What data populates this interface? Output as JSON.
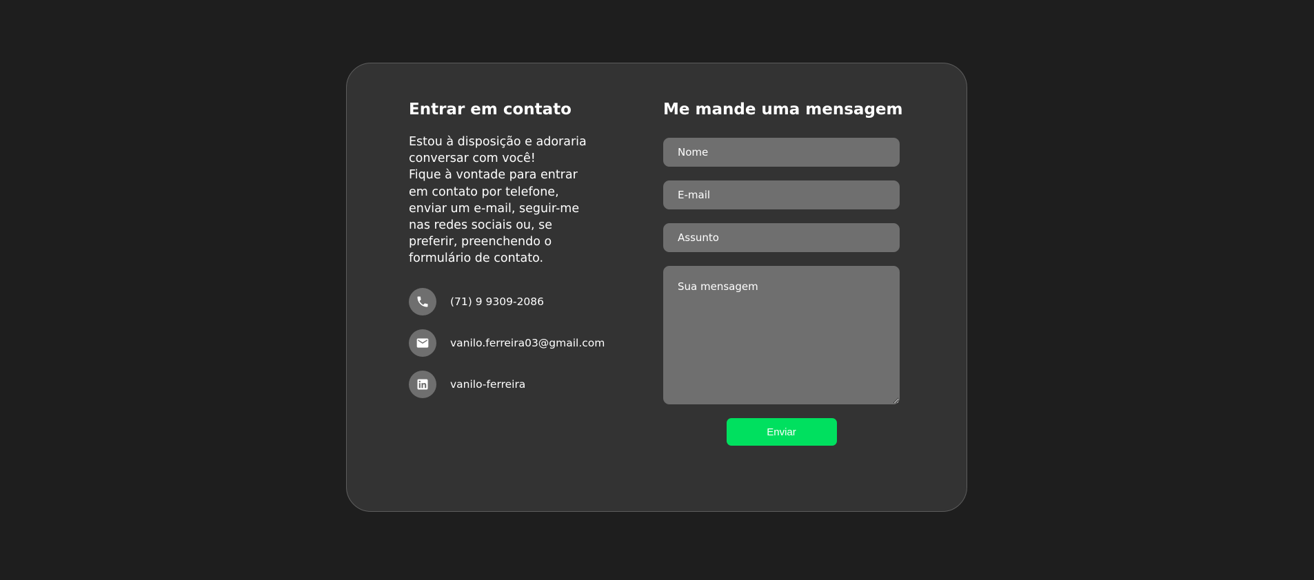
{
  "contact": {
    "title": "Entrar em contato",
    "intro_line1": "Estou à disposição e adoraria conversar com você!",
    "intro_line2": "Fique à vontade para entrar em contato por telefone, enviar um e-mail, seguir-me nas redes sociais ou, se preferir, preenchendo o formulário de contato.",
    "items": [
      {
        "icon": "phone-icon",
        "text": "(71) 9 9309-2086"
      },
      {
        "icon": "email-icon",
        "text": "vanilo.ferreira03@gmail.com"
      },
      {
        "icon": "linkedin-icon",
        "text": "vanilo-ferreira"
      }
    ]
  },
  "form": {
    "title": "Me mande uma mensagem",
    "name_placeholder": "Nome",
    "email_placeholder": "E-mail",
    "subject_placeholder": "Assunto",
    "message_placeholder": "Sua mensagem",
    "submit_label": "Enviar"
  },
  "colors": {
    "background": "#1e1e1e",
    "card": "#333333",
    "field": "#6f6f6f",
    "accent": "#00e05f"
  }
}
